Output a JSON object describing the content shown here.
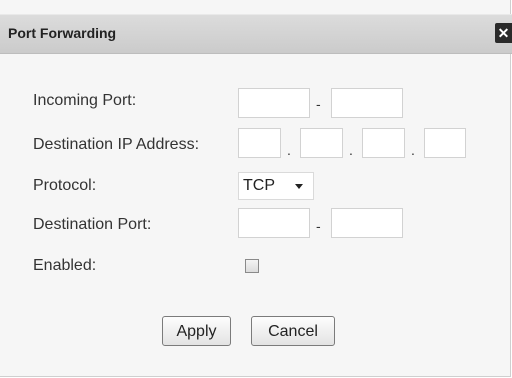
{
  "dialog": {
    "title": "Port Forwarding",
    "close_label": "✕"
  },
  "form": {
    "incoming_port": {
      "label": "Incoming Port:",
      "from": "",
      "to": "",
      "separator": "-"
    },
    "destination_ip": {
      "label": "Destination IP Address:",
      "octets": [
        "",
        "",
        "",
        ""
      ],
      "separator": "."
    },
    "protocol": {
      "label": "Protocol:",
      "selected": "TCP"
    },
    "destination_port": {
      "label": "Destination Port:",
      "from": "",
      "to": "",
      "separator": "-"
    },
    "enabled": {
      "label": "Enabled:",
      "checked": false
    }
  },
  "buttons": {
    "apply": "Apply",
    "cancel": "Cancel"
  }
}
